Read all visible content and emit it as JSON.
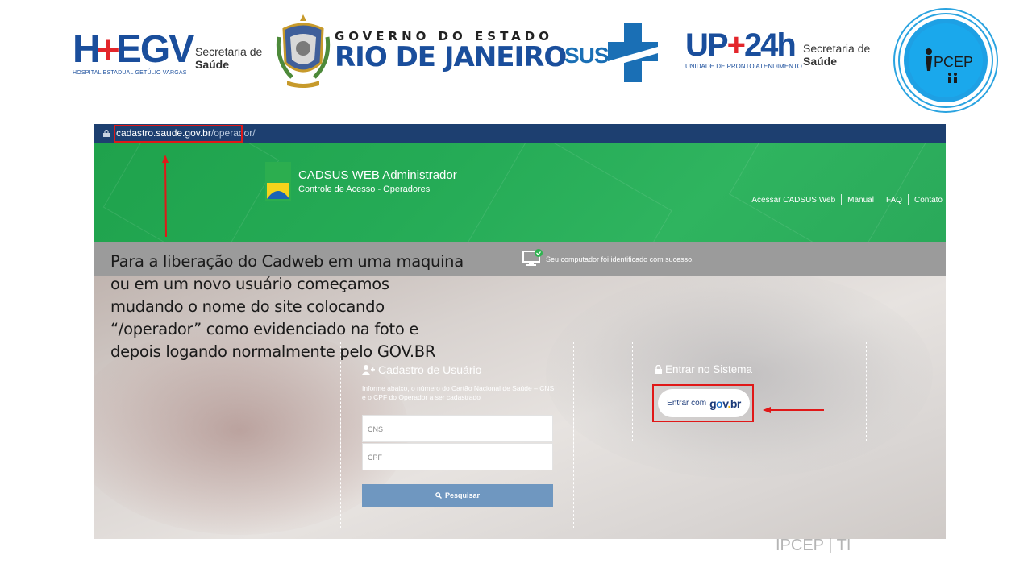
{
  "banner": {
    "hegv": {
      "mark_left": "H",
      "mark_cross": "+",
      "mark_right": "EGV",
      "subtitle": "HOSPITAL ESTADUAL GETÚLIO VARGAS"
    },
    "secretaria1": {
      "line1": "Secretaria de",
      "line2": "Saúde"
    },
    "governo": {
      "line1": "GOVERNO DO ESTADO",
      "line2": "RIO DE JANEIRO"
    },
    "sus": {
      "label": "SUS"
    },
    "upa": {
      "main_left": "UP",
      "main_plus": "+",
      "main_right": "24h",
      "subtitle": "UNIDADE DE PRONTO ATENDIMENTO"
    },
    "secretaria2": {
      "line1": "Secretaria de",
      "line2": "Saúde"
    },
    "ipcep_logo": {
      "label": "PCEP",
      "colors": {
        "ring": "#2aa3e0",
        "fill": "#1ea0e4"
      }
    }
  },
  "browser": {
    "url_domain": "cadastro.saude.gov.br",
    "url_path": "/operador/"
  },
  "cadsus": {
    "title": "CADSUS WEB Administrador",
    "subtitle": "Controle de Acesso - Operadores",
    "nav": [
      "Acessar CADSUS Web",
      "Manual",
      "FAQ",
      "Contato"
    ],
    "status_message": "Seu computador foi identificado com sucesso.",
    "cadastro": {
      "title": "Cadastro de Usuário",
      "info": "Informe abaixo, o número do Cartão Nacional de Saúde – CNS e o CPF do Operador a ser cadastrado",
      "cns_placeholder": "CNS",
      "cpf_placeholder": "CPF",
      "search_label": "Pesquisar"
    },
    "login": {
      "title": "Entrar no Sistema",
      "button_prefix": "Entrar com",
      "govbr": {
        "g": "g",
        "o": "o",
        "v": "v",
        "dot": ".",
        "b": "b",
        "r": "r"
      }
    },
    "colors": {
      "header_green": "#25ab56",
      "url_bar": "#1d3f70",
      "search_button": "#6f97c0",
      "highlight_red": "#e01818"
    }
  },
  "annotation": {
    "lines": [
      "Para a liberação do Cadweb em uma maquina",
      "ou em um novo usuário começamos",
      "mudando o nome do site colocando",
      "“/operador” como evidenciado na foto e",
      "depois logando normalmente pelo GOV.BR"
    ]
  },
  "footer": {
    "text": "IPCEP | TI"
  }
}
